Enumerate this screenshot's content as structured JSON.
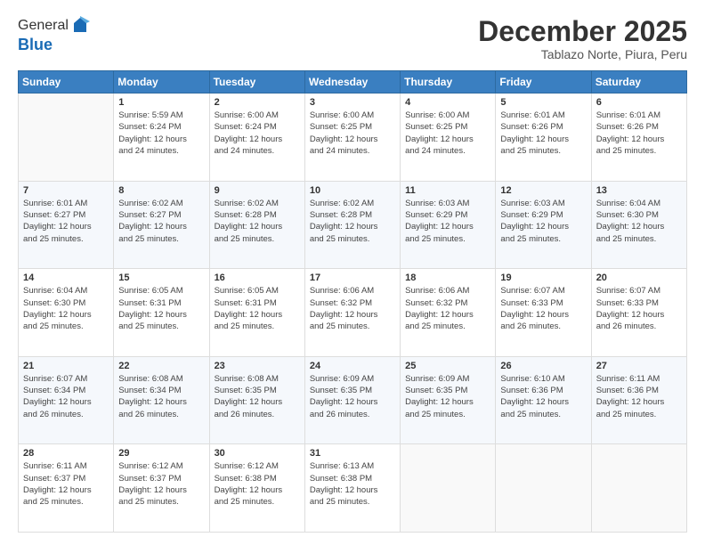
{
  "logo": {
    "general": "General",
    "blue": "Blue"
  },
  "title": "December 2025",
  "subtitle": "Tablazo Norte, Piura, Peru",
  "weekdays": [
    "Sunday",
    "Monday",
    "Tuesday",
    "Wednesday",
    "Thursday",
    "Friday",
    "Saturday"
  ],
  "weeks": [
    [
      {
        "day": "",
        "info": ""
      },
      {
        "day": "1",
        "info": "Sunrise: 5:59 AM\nSunset: 6:24 PM\nDaylight: 12 hours\nand 24 minutes."
      },
      {
        "day": "2",
        "info": "Sunrise: 6:00 AM\nSunset: 6:24 PM\nDaylight: 12 hours\nand 24 minutes."
      },
      {
        "day": "3",
        "info": "Sunrise: 6:00 AM\nSunset: 6:25 PM\nDaylight: 12 hours\nand 24 minutes."
      },
      {
        "day": "4",
        "info": "Sunrise: 6:00 AM\nSunset: 6:25 PM\nDaylight: 12 hours\nand 24 minutes."
      },
      {
        "day": "5",
        "info": "Sunrise: 6:01 AM\nSunset: 6:26 PM\nDaylight: 12 hours\nand 25 minutes."
      },
      {
        "day": "6",
        "info": "Sunrise: 6:01 AM\nSunset: 6:26 PM\nDaylight: 12 hours\nand 25 minutes."
      }
    ],
    [
      {
        "day": "7",
        "info": "Sunrise: 6:01 AM\nSunset: 6:27 PM\nDaylight: 12 hours\nand 25 minutes."
      },
      {
        "day": "8",
        "info": "Sunrise: 6:02 AM\nSunset: 6:27 PM\nDaylight: 12 hours\nand 25 minutes."
      },
      {
        "day": "9",
        "info": "Sunrise: 6:02 AM\nSunset: 6:28 PM\nDaylight: 12 hours\nand 25 minutes."
      },
      {
        "day": "10",
        "info": "Sunrise: 6:02 AM\nSunset: 6:28 PM\nDaylight: 12 hours\nand 25 minutes."
      },
      {
        "day": "11",
        "info": "Sunrise: 6:03 AM\nSunset: 6:29 PM\nDaylight: 12 hours\nand 25 minutes."
      },
      {
        "day": "12",
        "info": "Sunrise: 6:03 AM\nSunset: 6:29 PM\nDaylight: 12 hours\nand 25 minutes."
      },
      {
        "day": "13",
        "info": "Sunrise: 6:04 AM\nSunset: 6:30 PM\nDaylight: 12 hours\nand 25 minutes."
      }
    ],
    [
      {
        "day": "14",
        "info": "Sunrise: 6:04 AM\nSunset: 6:30 PM\nDaylight: 12 hours\nand 25 minutes."
      },
      {
        "day": "15",
        "info": "Sunrise: 6:05 AM\nSunset: 6:31 PM\nDaylight: 12 hours\nand 25 minutes."
      },
      {
        "day": "16",
        "info": "Sunrise: 6:05 AM\nSunset: 6:31 PM\nDaylight: 12 hours\nand 25 minutes."
      },
      {
        "day": "17",
        "info": "Sunrise: 6:06 AM\nSunset: 6:32 PM\nDaylight: 12 hours\nand 25 minutes."
      },
      {
        "day": "18",
        "info": "Sunrise: 6:06 AM\nSunset: 6:32 PM\nDaylight: 12 hours\nand 25 minutes."
      },
      {
        "day": "19",
        "info": "Sunrise: 6:07 AM\nSunset: 6:33 PM\nDaylight: 12 hours\nand 26 minutes."
      },
      {
        "day": "20",
        "info": "Sunrise: 6:07 AM\nSunset: 6:33 PM\nDaylight: 12 hours\nand 26 minutes."
      }
    ],
    [
      {
        "day": "21",
        "info": "Sunrise: 6:07 AM\nSunset: 6:34 PM\nDaylight: 12 hours\nand 26 minutes."
      },
      {
        "day": "22",
        "info": "Sunrise: 6:08 AM\nSunset: 6:34 PM\nDaylight: 12 hours\nand 26 minutes."
      },
      {
        "day": "23",
        "info": "Sunrise: 6:08 AM\nSunset: 6:35 PM\nDaylight: 12 hours\nand 26 minutes."
      },
      {
        "day": "24",
        "info": "Sunrise: 6:09 AM\nSunset: 6:35 PM\nDaylight: 12 hours\nand 26 minutes."
      },
      {
        "day": "25",
        "info": "Sunrise: 6:09 AM\nSunset: 6:35 PM\nDaylight: 12 hours\nand 25 minutes."
      },
      {
        "day": "26",
        "info": "Sunrise: 6:10 AM\nSunset: 6:36 PM\nDaylight: 12 hours\nand 25 minutes."
      },
      {
        "day": "27",
        "info": "Sunrise: 6:11 AM\nSunset: 6:36 PM\nDaylight: 12 hours\nand 25 minutes."
      }
    ],
    [
      {
        "day": "28",
        "info": "Sunrise: 6:11 AM\nSunset: 6:37 PM\nDaylight: 12 hours\nand 25 minutes."
      },
      {
        "day": "29",
        "info": "Sunrise: 6:12 AM\nSunset: 6:37 PM\nDaylight: 12 hours\nand 25 minutes."
      },
      {
        "day": "30",
        "info": "Sunrise: 6:12 AM\nSunset: 6:38 PM\nDaylight: 12 hours\nand 25 minutes."
      },
      {
        "day": "31",
        "info": "Sunrise: 6:13 AM\nSunset: 6:38 PM\nDaylight: 12 hours\nand 25 minutes."
      },
      {
        "day": "",
        "info": ""
      },
      {
        "day": "",
        "info": ""
      },
      {
        "day": "",
        "info": ""
      }
    ]
  ]
}
